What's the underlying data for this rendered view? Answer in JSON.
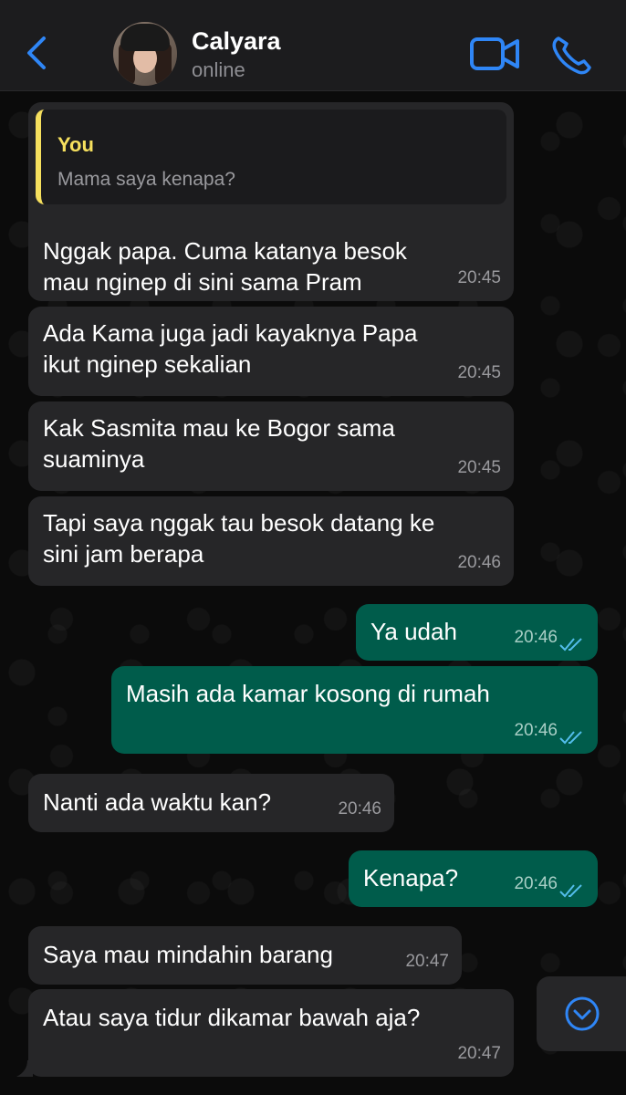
{
  "header": {
    "contact_name": "Calyara",
    "status": "online"
  },
  "messages": [
    {
      "direction": "in",
      "quote": {
        "author": "You",
        "text": "Mama saya kenapa?"
      },
      "lines": [
        "Nggak papa. Cuma katanya besok",
        "mau nginep di sini sama Pram"
      ],
      "time": "20:45"
    },
    {
      "direction": "in",
      "lines": [
        "Ada Kama juga jadi kayaknya Papa",
        "ikut nginep sekalian"
      ],
      "time": "20:45"
    },
    {
      "direction": "in",
      "lines": [
        "Kak Sasmita mau ke Bogor sama",
        "suaminya"
      ],
      "time": "20:45"
    },
    {
      "direction": "in",
      "lines": [
        "Tapi saya nggak tau besok datang ke",
        "sini jam berapa"
      ],
      "time": "20:46"
    },
    {
      "direction": "out",
      "lines": [
        "Ya udah"
      ],
      "time": "20:46",
      "read": true
    },
    {
      "direction": "out",
      "lines": [
        "Masih ada kamar kosong di rumah"
      ],
      "time": "20:46",
      "read": true
    },
    {
      "direction": "in",
      "lines": [
        "Nanti ada waktu kan?"
      ],
      "time": "20:46"
    },
    {
      "direction": "out",
      "lines": [
        "Kenapa?"
      ],
      "time": "20:46",
      "read": true
    },
    {
      "direction": "in",
      "lines": [
        "Saya mau mindahin barang"
      ],
      "time": "20:47"
    },
    {
      "direction": "in",
      "lines": [
        "Atau saya tidur dikamar bawah aja?"
      ],
      "time": "20:47"
    }
  ],
  "colors": {
    "accent": "#2f86f6",
    "incoming_bubble": "#262628",
    "outgoing_bubble": "#005c4b",
    "quote_author": "#f6e05e",
    "read_ticks": "#53bdeb"
  },
  "icons": {
    "back": "chevron-left-icon",
    "video": "video-camera-icon",
    "call": "phone-icon",
    "scroll": "chevron-down-circle-icon",
    "read": "double-check-icon"
  }
}
